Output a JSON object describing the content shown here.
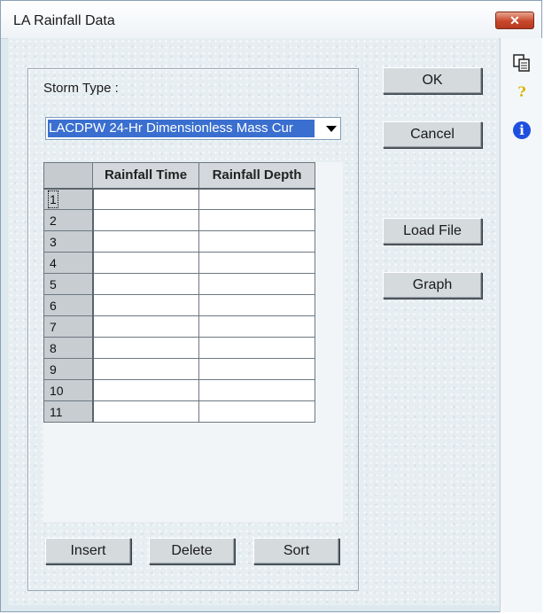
{
  "window": {
    "title": "LA Rainfall Data",
    "close_label": "✕"
  },
  "side_icons": {
    "copy": "copy-icon",
    "help": "?",
    "info": "i"
  },
  "storm": {
    "label": "Storm Type :",
    "selected": "LACDPW 24-Hr Dimensionless Mass Cur"
  },
  "grid": {
    "columns": [
      "Rainfall Time",
      "Rainfall Depth"
    ],
    "rows": [
      "1",
      "2",
      "3",
      "4",
      "5",
      "6",
      "7",
      "8",
      "9",
      "10",
      "11"
    ]
  },
  "buttons": {
    "ok": "OK",
    "cancel": "Cancel",
    "load_file": "Load File",
    "graph": "Graph",
    "insert": "Insert",
    "delete": "Delete",
    "sort": "Sort"
  }
}
